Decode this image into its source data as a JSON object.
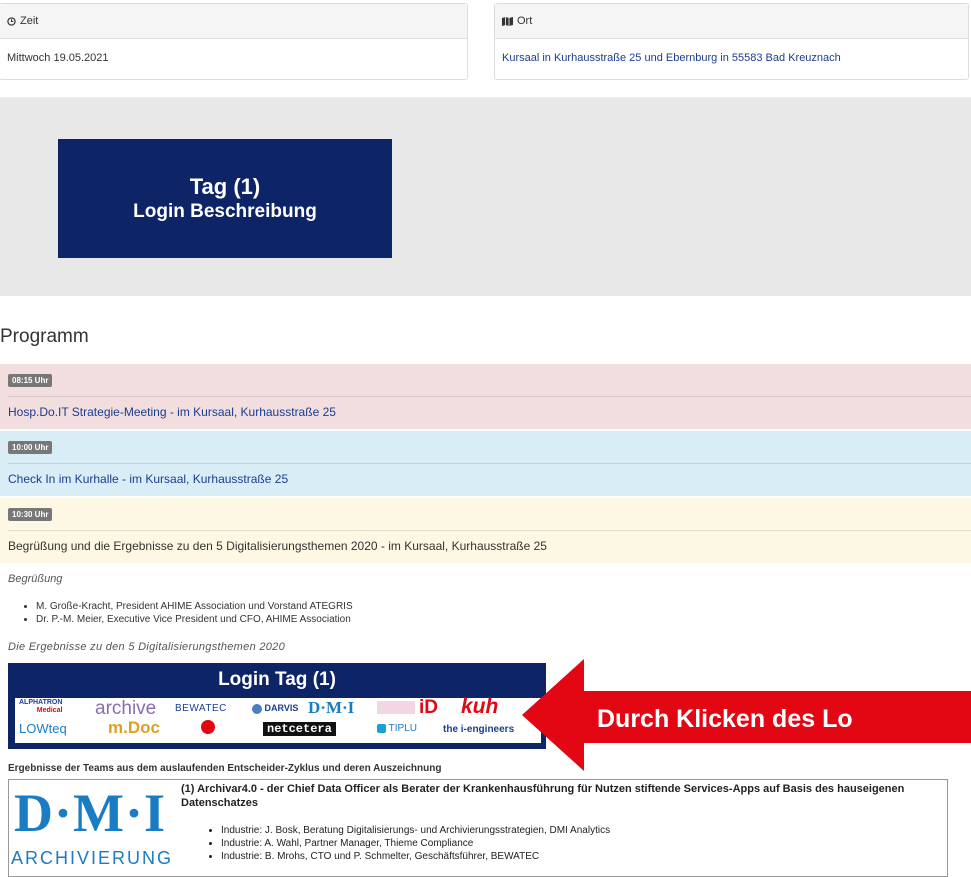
{
  "info": {
    "zeit_label": "Zeit",
    "zeit_value": "Mittwoch 19.05.2021",
    "ort_label": "Ort",
    "ort_value": "Kursaal in Kurhausstraße 25 und Ebernburg in 55583 Bad Kreuznach"
  },
  "banner": {
    "line1": "Tag (1)",
    "line2": "Login Beschreibung",
    "bg": "#0d2466"
  },
  "programm_heading": "Programm",
  "schedule": [
    {
      "time": "08:15 Uhr",
      "title": "Hosp.Do.IT Strategie-Meeting - im Kursaal, Kurhausstraße 25",
      "bg": "#f2dede"
    },
    {
      "time": "10:00 Uhr",
      "title": "Check In im Kurhalle - im Kursaal, Kurhausstraße 25",
      "bg": "#d9edf7"
    },
    {
      "time": "10:30 Uhr",
      "title": "Begrüßung und die Ergebnisse zu den 5 Digitalisierungsthemen 2020 - im Kursaal, Kurhausstraße 25",
      "bg": "#fcf8e3"
    }
  ],
  "begruessung": {
    "heading": "Begrüßung",
    "items": [
      "M. Große-Kracht, President AHIME Association und Vorstand ATEGRIS",
      "Dr. P.-M. Meier, Executive Vice President und CFO, AHIME Association"
    ]
  },
  "ergebnisse_heading": "Die Ergebnisse zu den 5 Digitalisierungsthemen 2020",
  "login_box": {
    "title": "Login Tag (1)",
    "logos": {
      "alphatron": "ALPHATRON",
      "alphatron_sub": "Medical",
      "archive": "archive",
      "bewatec": "BEWATEC",
      "darvis": "DARVIS",
      "dmi": "D·M·I",
      "id": "iD",
      "kuh": "kuh",
      "lowteq": "LOWteq",
      "mdoc": "m.Doc",
      "netcetera": "netcetera",
      "tiplu": "TIPLU",
      "iengineers": "the i-engineers"
    }
  },
  "callout": {
    "text": "Durch Klicken des Lo",
    "color": "#e30613"
  },
  "teams_heading": "Ergebnisse der Teams aus dem auslaufenden Entscheider-Zyklus und deren Auszeichnung",
  "dmi_card": {
    "logo_text": "D·M·I",
    "logo_sub": "ARCHIVIERUNG",
    "title": "(1) Archivar4.0 - der Chief Data Officer als Berater der Krankenhausführung für Nutzen stiftende Services-Apps auf Basis des hauseigenen Datenschatzes",
    "items": [
      "Industrie: J. Bosk, Beratung Digitalisierungs- und Archivierungsstrategien, DMI Analytics",
      "Industrie: A. Wahl, Partner Manager, Thieme Compliance",
      "Industrie: B. Mrohs, CTO und P. Schmelter, Geschäftsführer, BEWATEC"
    ]
  }
}
